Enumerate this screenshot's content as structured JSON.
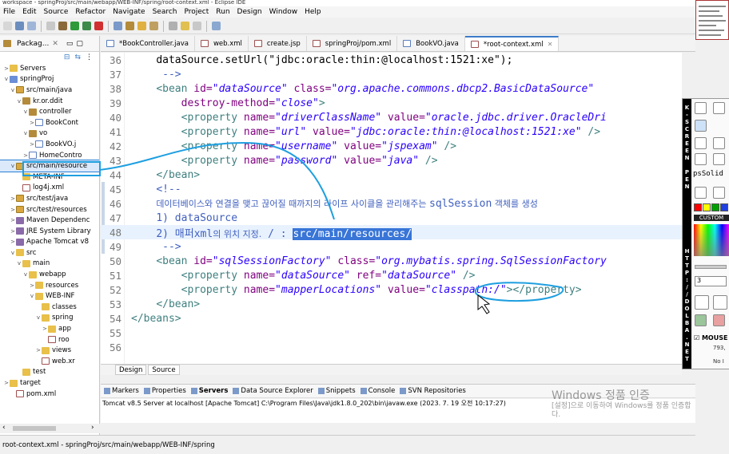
{
  "window": {
    "title": "workspace - springProj/src/main/webapp/WEB-INF/spring/root-context.xml - Eclipse IDE"
  },
  "menu": [
    "File",
    "Edit",
    "Source",
    "Refactor",
    "Navigate",
    "Search",
    "Project",
    "Run",
    "Design",
    "Window",
    "Help"
  ],
  "package_explorer": {
    "tab_label": "Packag...",
    "tree": [
      {
        "twisty": ">",
        "icon": "folder",
        "label": "Servers"
      },
      {
        "twisty": "v",
        "icon": "proj",
        "label": "springProj"
      },
      {
        "twisty": "v",
        "icon": "src",
        "label": "src/main/java"
      },
      {
        "twisty": "v",
        "icon": "pkg",
        "label": "kr.or.ddit"
      },
      {
        "twisty": "v",
        "icon": "pkg",
        "label": "controller"
      },
      {
        "twisty": ">",
        "icon": "java",
        "label": "BookCont"
      },
      {
        "twisty": "v",
        "icon": "pkg",
        "label": "vo"
      },
      {
        "twisty": ">",
        "icon": "java",
        "label": "BookVO.j"
      },
      {
        "twisty": ">",
        "icon": "java",
        "label": "HomeContro"
      },
      {
        "twisty": "v",
        "icon": "src",
        "label": "src/main/resource"
      },
      {
        "twisty": "",
        "icon": "folder",
        "label": "META-INF"
      },
      {
        "twisty": "",
        "icon": "xml",
        "label": "log4j.xml"
      },
      {
        "twisty": ">",
        "icon": "src",
        "label": "src/test/java"
      },
      {
        "twisty": ">",
        "icon": "src",
        "label": "src/test/resources"
      },
      {
        "twisty": ">",
        "icon": "lib",
        "label": "Maven Dependenc"
      },
      {
        "twisty": ">",
        "icon": "lib",
        "label": "JRE System Library"
      },
      {
        "twisty": ">",
        "icon": "lib",
        "label": "Apache Tomcat v8"
      },
      {
        "twisty": "v",
        "icon": "folder",
        "label": "src"
      },
      {
        "twisty": "v",
        "icon": "folder",
        "label": "main"
      },
      {
        "twisty": "v",
        "icon": "folder",
        "label": "webapp"
      },
      {
        "twisty": ">",
        "icon": "folder",
        "label": "resources"
      },
      {
        "twisty": "v",
        "icon": "folder",
        "label": "WEB-INF"
      },
      {
        "twisty": "",
        "icon": "folder",
        "label": "classes"
      },
      {
        "twisty": "v",
        "icon": "folder",
        "label": "spring"
      },
      {
        "twisty": ">",
        "icon": "folder",
        "label": "app"
      },
      {
        "twisty": "",
        "icon": "xml",
        "label": "roo"
      },
      {
        "twisty": ">",
        "icon": "folder",
        "label": "views"
      },
      {
        "twisty": "",
        "icon": "xml",
        "label": "web.xr"
      },
      {
        "twisty": "",
        "icon": "folder",
        "label": "test"
      },
      {
        "twisty": ">",
        "icon": "folder",
        "label": "target"
      },
      {
        "twisty": "",
        "icon": "xml",
        "label": "pom.xml"
      }
    ]
  },
  "editor_tabs": [
    {
      "label": "*BookController.java",
      "active": false
    },
    {
      "label": "web.xml",
      "active": false
    },
    {
      "label": "create.jsp",
      "active": false
    },
    {
      "label": "springProj/pom.xml",
      "active": false
    },
    {
      "label": "BookVO.java",
      "active": false
    },
    {
      "label": "*root-context.xml",
      "active": true
    }
  ],
  "code_lines": [
    {
      "n": "36",
      "html": "    <span class='t'>dataSource.setUrl(</span><span class='t'>\"jdbc:oracle:thin:@localhost:1521:xe\"</span><span class='t'>);</span>"
    },
    {
      "n": "37",
      "html": "     <span class='c'>--&gt;</span>"
    },
    {
      "n": "38",
      "html": "    <span class='k'>&lt;bean</span> <span class='a'>id=</span><span class='s'>\"dataSource\"</span> <span class='a'>class=</span><span class='s'>\"org.apache.commons.dbcp2.BasicDataSource\"</span>"
    },
    {
      "n": "39",
      "html": "        <span class='a'>destroy-method=</span><span class='s'>\"close\"</span><span class='k'>&gt;</span>"
    },
    {
      "n": "40",
      "html": "        <span class='k'>&lt;property</span> <span class='a'>name=</span><span class='s'>\"driverClassName\"</span> <span class='a'>value=</span><span class='s'>\"oracle.jdbc.driver.OracleDri</span>"
    },
    {
      "n": "41",
      "html": "        <span class='k'>&lt;property</span> <span class='a'>name=</span><span class='s'>\"url\"</span> <span class='a'>value=</span><span class='s'>\"jdbc:oracle:thin:@localhost:1521:xe\"</span> <span class='k'>/&gt;</span>"
    },
    {
      "n": "42",
      "html": "        <span class='k'>&lt;property</span> <span class='a'>name=</span><span class='s'>\"username\"</span> <span class='a'>value=</span><span class='s'>\"jspexam\"</span> <span class='k'>/&gt;</span>"
    },
    {
      "n": "43",
      "html": "        <span class='k'>&lt;property</span> <span class='a'>name=</span><span class='s'>\"password\"</span> <span class='a'>value=</span><span class='s'>\"java\"</span> <span class='k'>/&gt;</span>"
    },
    {
      "n": "44",
      "html": "    <span class='k'>&lt;/bean&gt;</span>"
    },
    {
      "n": "45",
      "html": "    <span class='c'>&lt;!--</span>"
    },
    {
      "n": "46",
      "html": "    <span class='ck'>데이터베이스와 연결을 맺고 끊어질 때까지의 라이프 사이클을 관리해주는 </span><span class='c'>sqlSession</span><span class='ck'> 객체를 생성</span>"
    },
    {
      "n": "47",
      "html": "    <span class='c'>1) dataSource</span>"
    },
    {
      "n": "48",
      "html": "    <span class='c'>2) 매퍼</span><span class='c'>xml</span><span class='ck'>의 위치 지정.</span><span class='c'> / : </span><span class='hl'>src/main/resources/</span>"
    },
    {
      "n": "49",
      "html": "     <span class='c'>--&gt;</span>"
    },
    {
      "n": "50",
      "html": "    <span class='k'>&lt;bean</span> <span class='a'>id=</span><span class='s'>\"sqlSessionFactory\"</span> <span class='a'>class=</span><span class='s'>\"org.mybatis.spring.SqlSessionFactory</span>"
    },
    {
      "n": "51",
      "html": "        <span class='k'>&lt;property</span> <span class='a'>name=</span><span class='s'>\"dataSource\"</span> <span class='a'>ref=</span><span class='s'>\"dataSource\"</span> <span class='k'>/&gt;</span>"
    },
    {
      "n": "52",
      "html": "        <span class='k'>&lt;property</span> <span class='a'>name=</span><span class='s'>\"mapperLocations\"</span> <span class='a'>value=</span><span class='s'>\"classpath:/\"</span><span class='k'>&gt;&lt;/property&gt;</span>"
    },
    {
      "n": "53",
      "html": "    <span class='k'>&lt;/bean&gt;</span>"
    },
    {
      "n": "54",
      "html": "<span class='k'>&lt;/beans&gt;</span>"
    },
    {
      "n": "55",
      "html": ""
    },
    {
      "n": "56",
      "html": ""
    }
  ],
  "editor_bottom_tabs": [
    {
      "label": "Design",
      "active": false
    },
    {
      "label": "Source",
      "active": true
    }
  ],
  "console_tabs": [
    "Markers",
    "Properties",
    "Servers",
    "Data Source Explorer",
    "Snippets",
    "Console",
    "SVN Repositories"
  ],
  "console_text": "Tomcat v8.5 Server at localhost [Apache Tomcat] C:\\Program Files\\Java\\jdk1.8.0_202\\bin\\javaw.exe  (2023. 7. 19 오전 10:17:27)",
  "status_bar": "root-context.xml - springProj/src/main/webapp/WEB-INF/spring",
  "watermark": {
    "line1": "Windows 정품 인증",
    "line2": "[설정]으로 이동하여 Windows를 정품 인증합",
    "line3": "다."
  },
  "pen_panel": {
    "vertical_text": [
      "K",
      "-",
      "S",
      "C",
      "R",
      "E",
      "E",
      "N",
      "",
      "P",
      "E",
      "N",
      "",
      "",
      "",
      "",
      "",
      "",
      "",
      "",
      "H",
      "T",
      "T",
      "P",
      ":",
      "/",
      "/",
      "D",
      "O",
      "L",
      "B",
      "A",
      ".",
      "N",
      "E",
      "T"
    ],
    "style_label": "psSolid",
    "custom_label": "CUSTOM",
    "size_value": "3",
    "mouse_label": "MOUSE",
    "coord": "793,",
    "no_label": "No I",
    "swatches": [
      "#ff0000",
      "#ffff00",
      "#00a000",
      "#2040e0"
    ]
  },
  "colors": {
    "accent": "#3d7cc9",
    "selection": "#3875d7",
    "annotation": "#1e9fe0"
  }
}
